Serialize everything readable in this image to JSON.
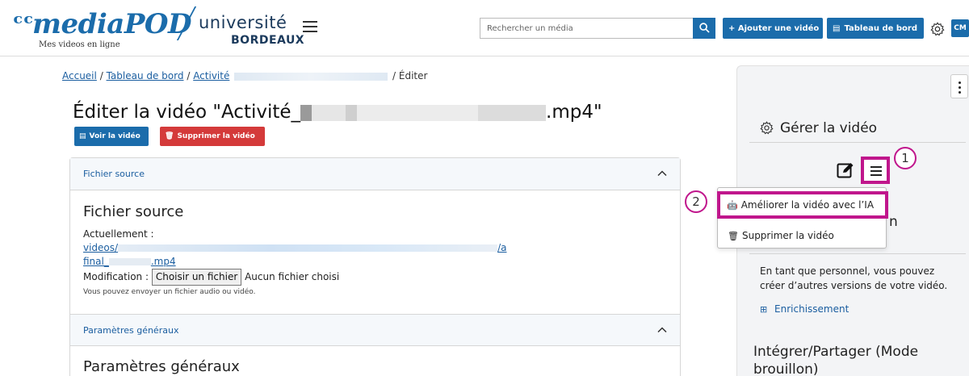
{
  "header": {
    "logo_mark": "ᶜᶜ",
    "logo_text": "mediaPOD",
    "logo_tagline": "Mes videos en ligne",
    "university_name": "université",
    "university_sub": "BORDEAUX",
    "search_placeholder": "Rechercher un média",
    "add_video_label": "+ Ajouter une vidéo",
    "dashboard_label": "Tableau de bord",
    "avatar_initials": "CM"
  },
  "breadcrumb": {
    "home": "Accueil",
    "separator": "/",
    "dashboard": "Tableau de bord",
    "activity": "Activité",
    "current": "Éditer"
  },
  "page": {
    "title_prefix": "Éditer la vidéo \"Activité_",
    "title_suffix": ".mp4\"",
    "view_button": "Voir la vidéo",
    "delete_button": "Supprimer la vidéo"
  },
  "source_section": {
    "header_label": "Fichier source",
    "title": "Fichier source",
    "current_label": "Actuellement :",
    "path_start": "videos/",
    "path_end": "/a",
    "file_start": "final_",
    "file_end": ".mp4",
    "modify_label": "Modification :",
    "choose_file": "Choisir un fichier",
    "no_file": "Aucun fichier choisi",
    "hint": "Vous pouvez envoyer un fichier audio ou vidéo."
  },
  "general_section": {
    "header_label": "Paramètres généraux",
    "title": "Paramètres généraux"
  },
  "panel": {
    "manage_title": "Gérer la vidéo",
    "annotation_1": "1",
    "annotation_2": "2",
    "menu_items": [
      {
        "label": "Améliorer la vidéo avec l’IA",
        "icon": "robot-icon"
      },
      {
        "label": "Supprimer la vidéo",
        "icon": "trash-icon"
      }
    ],
    "hidden_heading_tail": "n",
    "staff_text": "En tant que personnel, vous pouvez créer d’autres versions de votre vidéo.",
    "enrich_label": "Enrichissement",
    "embed_title": "Intégrer/Partager (Mode brouillon)"
  },
  "colors": {
    "brand_blue": "#1b6cab",
    "danger_red": "#d43a3a",
    "highlight_magenta": "#c0168c"
  }
}
